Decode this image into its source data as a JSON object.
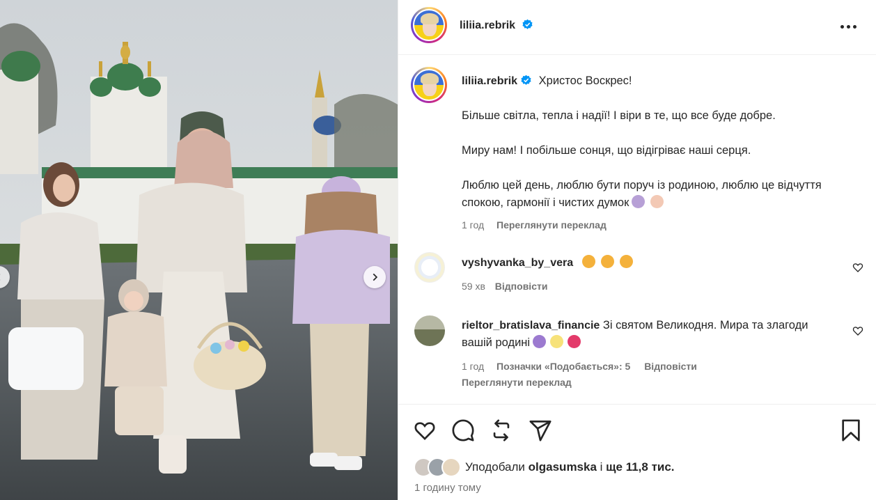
{
  "post": {
    "username": "liliia.rebrik",
    "caption_title": "Христос Воскрес!",
    "caption_p1": "Більше світла, тепла і надії! І віри в те, що все буде добре.",
    "caption_p2": "Миру нам! І побільше сонця, що відігріває наші серця.",
    "caption_p3": "Люблю цей день, люблю бути поруч із родиною, люблю це відчуття спокою, гармонії і чистих думок",
    "caption_time": "1 год",
    "caption_translate": "Переглянути переклад"
  },
  "comments": [
    {
      "username": "vyshyvanka_by_vera",
      "text": "",
      "time": "59 хв",
      "reply": "Відповісти"
    },
    {
      "username": "rieltor_bratislava_financie",
      "text": "Зі святом Великодня. Мира та злагоди вашій родині",
      "time": "1 год",
      "likes": "Позначки «Подобається»: 5",
      "reply": "Відповісти",
      "translate": "Переглянути переклад"
    }
  ],
  "likes": {
    "prefix": "Уподобали",
    "user": "olgasumska",
    "middle": "і",
    "count": "ще 11,8 тис."
  },
  "posted": "1 годину тому",
  "icons": {
    "verified": "verified-badge-icon",
    "more": "more-options-icon",
    "like": "heart-icon",
    "comment": "comment-icon",
    "repost": "repost-icon",
    "share": "share-icon",
    "save": "bookmark-icon"
  },
  "colors": {
    "verified_blue": "#0095f6",
    "muted_text": "#737373",
    "primary_text": "#262626"
  }
}
